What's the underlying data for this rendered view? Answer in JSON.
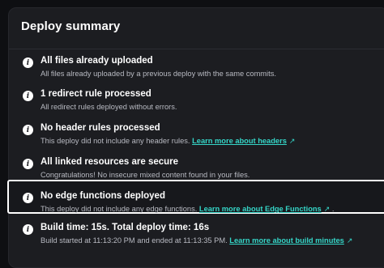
{
  "title": "Deploy summary",
  "items": [
    {
      "heading": "All files already uploaded",
      "text": "All files already uploaded by a previous deploy with the same commits.",
      "link": ""
    },
    {
      "heading": "1 redirect rule processed",
      "text": "All redirect rules deployed without errors.",
      "link": ""
    },
    {
      "heading": "No header rules processed",
      "text": "This deploy did not include any header rules.",
      "link": "Learn more about headers",
      "after": ""
    },
    {
      "heading": "All linked resources are secure",
      "text": "Congratulations! No insecure mixed content found in your files.",
      "link": ""
    },
    {
      "heading": "No edge functions deployed",
      "text": "This deploy did not include any edge functions.",
      "link": "Learn more about Edge Functions",
      "after": "."
    },
    {
      "heading": "Build time: 15s. Total deploy time: 16s",
      "text": "Build started at 11:13:20 PM and ended at 11:13:35 PM.",
      "link": "Learn more about build minutes",
      "after": ""
    }
  ],
  "info_icon": "info-icon",
  "external_icon": "external-link-icon",
  "colors": {
    "link": "#35d6c8",
    "background": "#1c1d21"
  }
}
